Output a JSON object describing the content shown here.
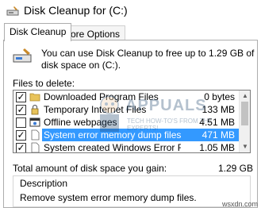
{
  "window": {
    "title": "Disk Cleanup for  (C:)",
    "icon": "disk-cleanup-icon"
  },
  "tabs": [
    {
      "label": "Disk Cleanup",
      "active": true
    },
    {
      "label": "More Options",
      "active": false
    }
  ],
  "intro": "You can use Disk Cleanup to free up to 1.29 GB of disk space on  (C:).",
  "files_label": "Files to delete:",
  "files": [
    {
      "checked": true,
      "icon": "folder-icon",
      "name": "Downloaded Program Files",
      "size": "0 bytes",
      "selected": false
    },
    {
      "checked": true,
      "icon": "lock-icon",
      "name": "Temporary Internet Files",
      "size": "133 MB",
      "selected": false
    },
    {
      "checked": false,
      "icon": "webpage-icon",
      "name": "Offline webpages",
      "size": "4.51 MB",
      "selected": false
    },
    {
      "checked": true,
      "icon": "file-icon",
      "name": "System error memory dump files",
      "size": "471 MB",
      "selected": true
    },
    {
      "checked": true,
      "icon": "file-icon",
      "name": "System created Windows Error Reporti...",
      "size": "1.05 MB",
      "selected": false
    }
  ],
  "total": {
    "label": "Total amount of disk space you gain:",
    "value": "1.29 GB"
  },
  "description": {
    "title": "Description",
    "text": "Remove system error memory dump files."
  },
  "watermark": {
    "text": "APPUALS",
    "sub": "TECH HOW-TO'S FROM THE EXPERTS!"
  },
  "site": "wsxdn.com",
  "colors": {
    "selection": "#3399ff",
    "accent": "#2a4f74"
  }
}
